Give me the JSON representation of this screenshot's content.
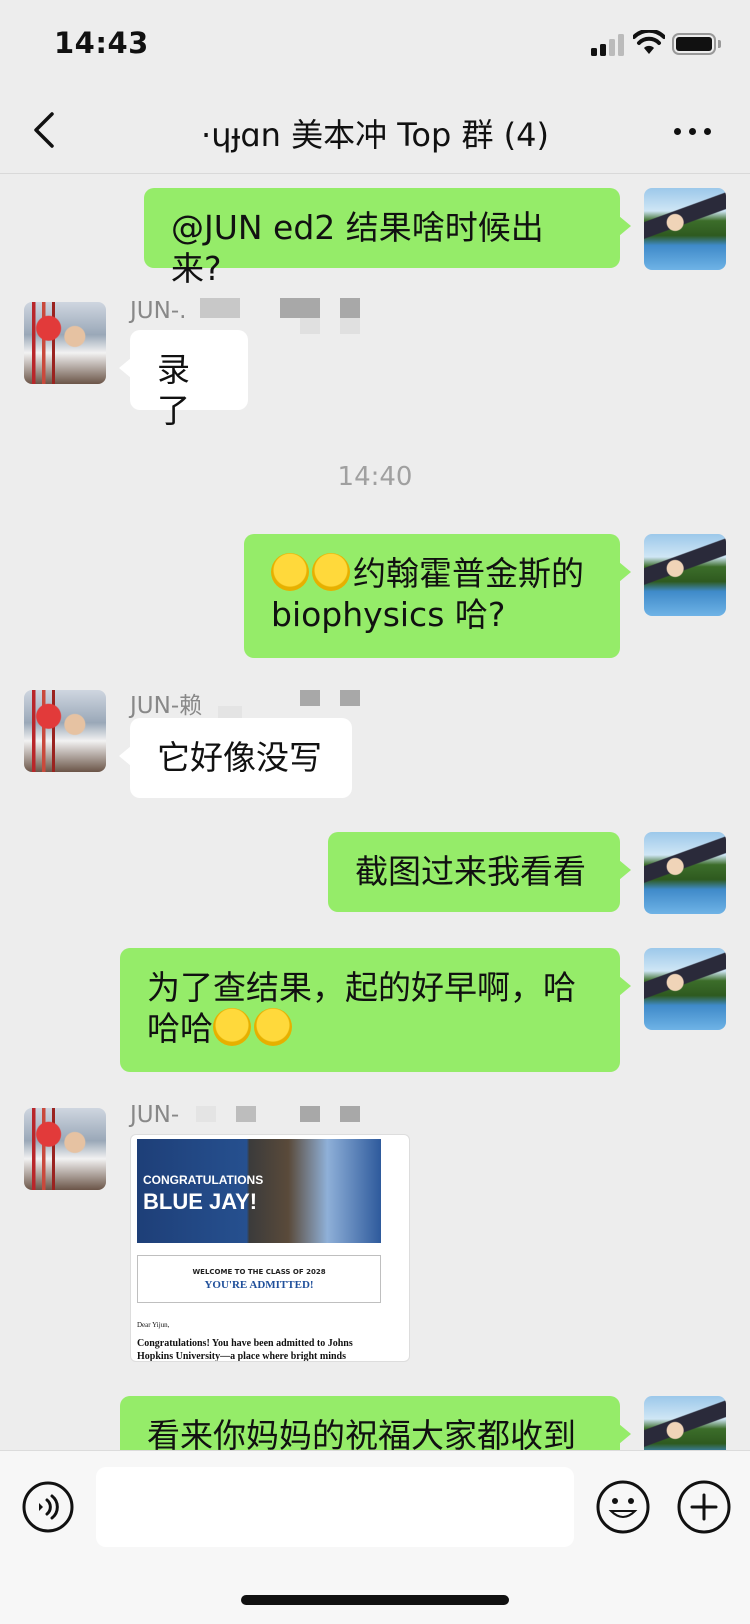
{
  "status_bar": {
    "time": "14:43"
  },
  "nav": {
    "title": "·ɥɟɑn 美本冲 Top 群 (4)"
  },
  "messages": [
    {
      "id": "m1",
      "sender": "me",
      "text": "@JUN ed2 结果啥时候出来?"
    },
    {
      "id": "m2",
      "sender": "JUN-",
      "sender_name": "JUN-.",
      "text": "录了"
    },
    {
      "id": "m3",
      "sender": "me",
      "emoji": "hug",
      "text_line1": "约翰霍普金斯的",
      "text_line2": "biophysics 哈?"
    },
    {
      "id": "m4",
      "sender": "JUN-",
      "sender_name": "JUN-赖",
      "text": "它好像没写"
    },
    {
      "id": "m5",
      "sender": "me",
      "text": "截图过来我看看"
    },
    {
      "id": "m6",
      "sender": "me",
      "text_line1": "为了查结果，起的好早啊，哈",
      "text_line2": "哈哈"
    },
    {
      "id": "m7",
      "sender": "JUN-",
      "sender_name": "JUN-",
      "type": "image"
    },
    {
      "id": "m8",
      "sender": "me",
      "text": "看来你妈妈的祝福大家都收到"
    }
  ],
  "timestamp": "14:40",
  "admission_image": {
    "congrats": "CONGRATULATIONS",
    "blue_jay": "BLUE JAY!",
    "welcome": "WELCOME TO THE CLASS OF 2028",
    "admitted": "YOU'RE ADMITTED!",
    "dear": "Dear Yijun,",
    "body": "Congratulations! You have been admitted to Johns Hopkins University—a place where bright minds"
  },
  "input_bar": {
    "placeholder": ""
  },
  "colors": {
    "mine_bubble": "#95ec69",
    "theirs_bubble": "#ffffff",
    "background": "#ededed"
  }
}
